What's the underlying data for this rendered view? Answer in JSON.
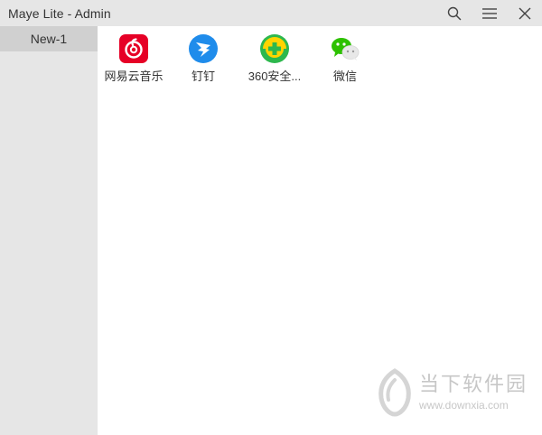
{
  "window": {
    "title": "Maye Lite - Admin"
  },
  "controls": {
    "search_icon": "search-icon",
    "menu_icon": "menu-icon",
    "close_icon": "close-icon"
  },
  "sidebar": {
    "tabs": [
      {
        "label": "New-1",
        "selected": true
      }
    ]
  },
  "apps": [
    {
      "label": "网易云音乐",
      "icon": "netease-music-icon",
      "color": "#e60026"
    },
    {
      "label": "钉钉",
      "icon": "dingtalk-icon",
      "color": "#1f8ceb"
    },
    {
      "label": "360安全...",
      "icon": "360-security-icon",
      "color": "#2db84d"
    },
    {
      "label": "微信",
      "icon": "wechat-icon",
      "color": "#2dc100"
    }
  ],
  "watermark": {
    "text": "当下软件园",
    "url": "www.downxia.com"
  },
  "colors": {
    "titlebar": "#e6e6e6",
    "sidebar": "#e6e6e6",
    "tab_selected": "#d0d0d0",
    "content": "#ffffff"
  }
}
